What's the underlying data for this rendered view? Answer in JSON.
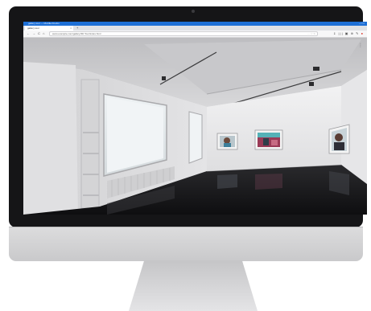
{
  "browser": {
    "window_title": "gallery tour — Mozilla Firefox",
    "window_controls": "–  □  ×",
    "tab_label": "gallery tour",
    "tab_close": "×",
    "new_tab": "+",
    "nav_back": "←",
    "nav_forward": "→",
    "nav_reload": "C",
    "nav_home": "⌂",
    "url_text": "www.example.com/gallery/3D Tour/index.html",
    "url_actions": "··· ♡ ☆",
    "toolbar_icons": "⇓ ||| ▣ ⊕ ✎"
  },
  "scene": {
    "menu_icon": "⋮",
    "artworks": [
      "portrait-artwork-left",
      "interior-artwork-center",
      "portrait-artwork-right"
    ]
  },
  "colors": {
    "bezel": "#151517",
    "title_bar": "#1d6fd6",
    "wall": "#e7e7e8",
    "floor": "#1b1b1d"
  }
}
